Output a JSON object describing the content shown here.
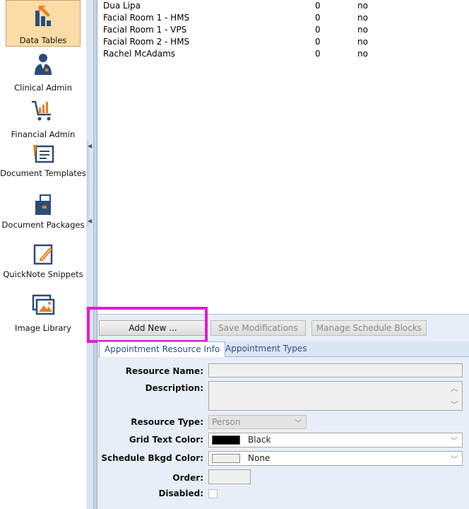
{
  "sidebar": {
    "items": [
      {
        "label": "Data Tables",
        "icon": "data-tables-icon",
        "active": true
      },
      {
        "label": "Clinical Admin",
        "icon": "doctor-icon"
      },
      {
        "label": "Financial Admin",
        "icon": "cart-icon"
      },
      {
        "label": "Document Templates",
        "icon": "document-template-icon"
      },
      {
        "label": "Document Packages",
        "icon": "document-package-icon"
      },
      {
        "label": "QuickNote Snippets",
        "icon": "quicknote-icon"
      },
      {
        "label": "Image Library",
        "icon": "image-library-icon"
      }
    ]
  },
  "list": {
    "rows": [
      {
        "name": "Dua Lipa",
        "count": "0",
        "flag": "no"
      },
      {
        "name": "Facial Room 1 - HMS",
        "count": "0",
        "flag": "no"
      },
      {
        "name": "Facial Room 1 - VPS",
        "count": "0",
        "flag": "no"
      },
      {
        "name": "Facial Room 2 - HMS",
        "count": "0",
        "flag": "no"
      },
      {
        "name": "Rachel McAdams",
        "count": "0",
        "flag": "no"
      }
    ]
  },
  "toolbar": {
    "add_label": "Add New ...",
    "save_label": "Save Modifications",
    "manage_label": "Manage Schedule Blocks"
  },
  "tabs": [
    {
      "label": "Appointment Resource Info",
      "active": true
    },
    {
      "label": "Appointment Types"
    }
  ],
  "form": {
    "resource_name_label": "Resource Name:",
    "resource_name_value": "",
    "description_label": "Description:",
    "description_value": "",
    "resource_type_label": "Resource Type:",
    "resource_type_value": "Person",
    "grid_text_color_label": "Grid Text Color:",
    "grid_text_color_value": "Black",
    "grid_text_color_swatch": "#000000",
    "schedule_bkgd_label": "Schedule Bkgd Color:",
    "schedule_bkgd_value": "None",
    "schedule_bkgd_swatch": "#f0f0f0",
    "order_label": "Order:",
    "order_value": "",
    "disabled_label": "Disabled:"
  },
  "colors": {
    "highlight": "#e21bd0",
    "active_nav": "#fcdca6",
    "tab_text": "#2a4d86"
  }
}
